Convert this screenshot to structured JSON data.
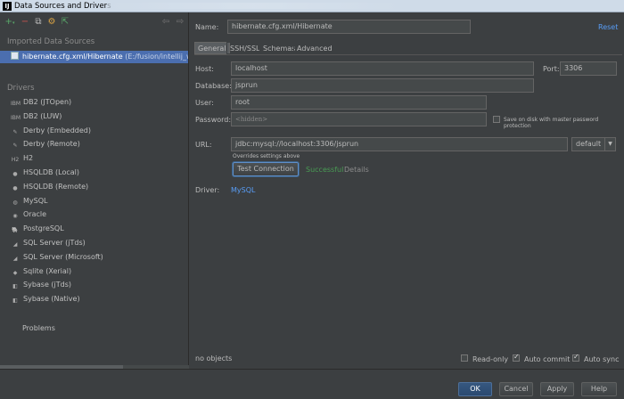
{
  "window": {
    "title": "Data Sources and Drivers"
  },
  "sidebar": {
    "section_sources": "Imported Data Sources",
    "source": {
      "name": "hibernate.cfg.xml/Hibernate",
      "path": "(E:/fusion/intellij_work"
    },
    "section_drivers": "Drivers",
    "drivers": [
      {
        "label": "DB2 (JTOpen)",
        "icon": "ibm-icon"
      },
      {
        "label": "DB2 (LUW)",
        "icon": "ibm-icon"
      },
      {
        "label": "Derby (Embedded)",
        "icon": "derby-icon"
      },
      {
        "label": "Derby (Remote)",
        "icon": "derby-icon"
      },
      {
        "label": "H2",
        "icon": "h2-icon"
      },
      {
        "label": "HSQLDB (Local)",
        "icon": "hsqldb-icon"
      },
      {
        "label": "HSQLDB (Remote)",
        "icon": "hsqldb-icon"
      },
      {
        "label": "MySQL",
        "icon": "mysql-icon"
      },
      {
        "label": "Oracle",
        "icon": "oracle-icon"
      },
      {
        "label": "PostgreSQL",
        "icon": "postgresql-icon"
      },
      {
        "label": "SQL Server (jTds)",
        "icon": "sqlserver-icon"
      },
      {
        "label": "SQL Server (Microsoft)",
        "icon": "sqlserver-icon"
      },
      {
        "label": "Sqlite (Xerial)",
        "icon": "sqlite-icon"
      },
      {
        "label": "Sybase (jTds)",
        "icon": "sybase-icon"
      },
      {
        "label": "Sybase (Native)",
        "icon": "sybase-icon"
      }
    ],
    "problems": "Problems"
  },
  "form": {
    "name_label": "Name:",
    "name_value": "hibernate.cfg.xml/Hibernate",
    "reset": "Reset",
    "tabs": [
      "General",
      "SSH/SSL",
      "Schemas",
      "Advanced"
    ],
    "host_label": "Host:",
    "host_value": "localhost",
    "port_label": "Port:",
    "port_value": "3306",
    "database_label": "Database:",
    "database_value": "jsprun",
    "user_label": "User:",
    "user_value": "root",
    "password_label": "Password:",
    "password_placeholder": "<hidden>",
    "save_password_label": "Save on disk with master password protection",
    "url_label": "URL:",
    "url_value": "jdbc:mysql://localhost:3306/jsprun",
    "url_mode": "default",
    "overrides_note": "Overrides settings above",
    "test_button": "Test Connection",
    "test_status": "Successful",
    "details": "Details",
    "driver_label": "Driver:",
    "driver_value": "MySQL",
    "status_text": "no objects",
    "readonly_label": "Read-only",
    "autocommit_label": "Auto commit",
    "autosync_label": "Auto sync"
  },
  "buttons": {
    "ok": "OK",
    "cancel": "Cancel",
    "apply": "Apply",
    "help": "Help"
  },
  "colors": {
    "background": "#3c3f41",
    "selection": "#4b6eaf",
    "link": "#589df6",
    "success": "#499c54"
  }
}
